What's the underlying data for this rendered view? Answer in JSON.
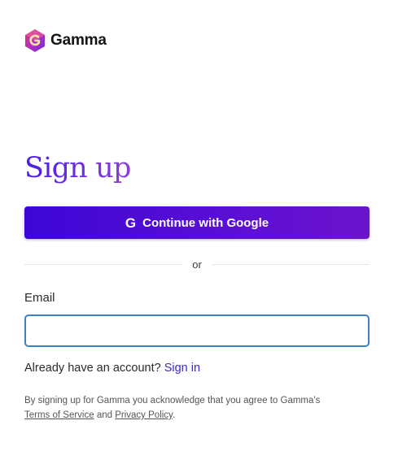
{
  "brand": {
    "name": "Gamma",
    "logo_icon": "gamma-logo-icon",
    "colors": {
      "logo_pink": "#e0327a",
      "logo_purple": "#6a2bd9",
      "button_start": "#3c07d6",
      "button_end": "#6b14cc",
      "link": "#3b28cc",
      "input_focus_border": "#3b82c4"
    }
  },
  "form": {
    "title": "Sign up",
    "google_button": {
      "icon": "google-g-icon",
      "icon_glyph": "G",
      "label": "Continue with Google"
    },
    "divider_text": "or",
    "email": {
      "label": "Email",
      "value": "",
      "placeholder": ""
    },
    "already_account": {
      "text": "Already have an account?",
      "link_label": "Sign in"
    },
    "legal": {
      "prefix": "By signing up for Gamma you acknowledge that you agree to Gamma's",
      "terms_label": "Terms of Service",
      "and": "and",
      "privacy_label": "Privacy Policy",
      "suffix": "."
    }
  }
}
